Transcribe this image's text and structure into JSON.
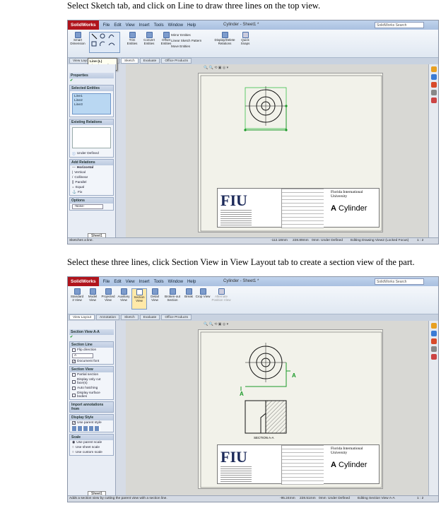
{
  "captions": {
    "step1": "Select Sketch tab, and click on Line to draw three lines on the top view.",
    "step2": "Select these three lines, click Section View in View Layout tab to create a section view of the part."
  },
  "app": {
    "name": "SolidWorks",
    "menus": [
      "File",
      "Edit",
      "View",
      "Insert",
      "Tools",
      "Window",
      "Help"
    ],
    "window_title": "Cylinder - Sheet1 *",
    "search_placeholder": "SolidWorks Search"
  },
  "shot1": {
    "ribbon": [
      "Smart Dimension",
      "Trim Entities",
      "Convert Entities",
      "Offset Entities",
      "Mirror Entities",
      "Linear Sketch Pattern",
      "Move Entities",
      "Display/Delete Relations",
      "Quick Snaps"
    ],
    "tabs": [
      "View Layout",
      "Annotation",
      "Sketch",
      "Evaluate",
      "Office Products"
    ],
    "tooltip": {
      "title": "Line (L)",
      "body": "Sketches a line."
    },
    "panel_title": "Properties",
    "selected_header": "Selected Entities",
    "selected": [
      "Line1",
      "Line2",
      "Line3"
    ],
    "existing_header": "Existing Relations",
    "under_defined": "Under Defined",
    "add_header": "Add Relations",
    "relations": [
      "Horizontal",
      "Vertical",
      "Collinear",
      "Parallel",
      "Equal",
      "Fix"
    ],
    "options_header": "Options",
    "options_value": "-None-",
    "sheet_tab": "Sheet1",
    "status": [
      "Sketches a line.",
      "-112.18mm",
      "228.89mm",
      "0mm",
      "Under Defined",
      "Editing Drawing View2 (Locked Focus)",
      "1 : 2"
    ]
  },
  "shot2": {
    "ribbon": [
      "Standard 3 View",
      "Model View",
      "Projected View",
      "Auxiliary View",
      "Section View",
      "Detail View",
      "Broken-out Section",
      "Break",
      "Crop View",
      "Alternate Position View"
    ],
    "tabs": [
      "View Layout",
      "Annotation",
      "Sketch",
      "Evaluate",
      "Office Products"
    ],
    "tooltip": {
      "title": "Section View",
      "body": "Adds a section view by cutting the parent view with a section line."
    },
    "panel_title": "Section View A-A",
    "section_line_header": "Section Line",
    "flip": "Flip direction",
    "letter": "A",
    "doc_font": "Document font",
    "section_view_header": "Section View",
    "section_view_opts": [
      "Partial section",
      "Display only cut face(s)",
      "Auto hatching",
      "Display surface bodies"
    ],
    "import_header": "Import annotations from",
    "display_header": "Display Style",
    "parent_style": "Use parent style",
    "scale_header": "Scale",
    "scales": [
      "Use parent scale",
      "Use sheet scale",
      "Use custom scale"
    ],
    "label_a": "A",
    "section_caption": "SECTION A-A",
    "sheet_tab": "Sheet1",
    "status": [
      "Adds a section view by cutting the parent view with a section line.",
      "-95.24mm",
      "228.51mm",
      "0mm",
      "Under Defined",
      "Editing Section View A-A",
      "1 : 2"
    ]
  },
  "titleblock": {
    "logo": "FIU",
    "org": "Florida International University",
    "part": "Cylinder",
    "letter": "A"
  },
  "colors": {
    "accent": "#b0141c",
    "green": "#1a9a28"
  }
}
